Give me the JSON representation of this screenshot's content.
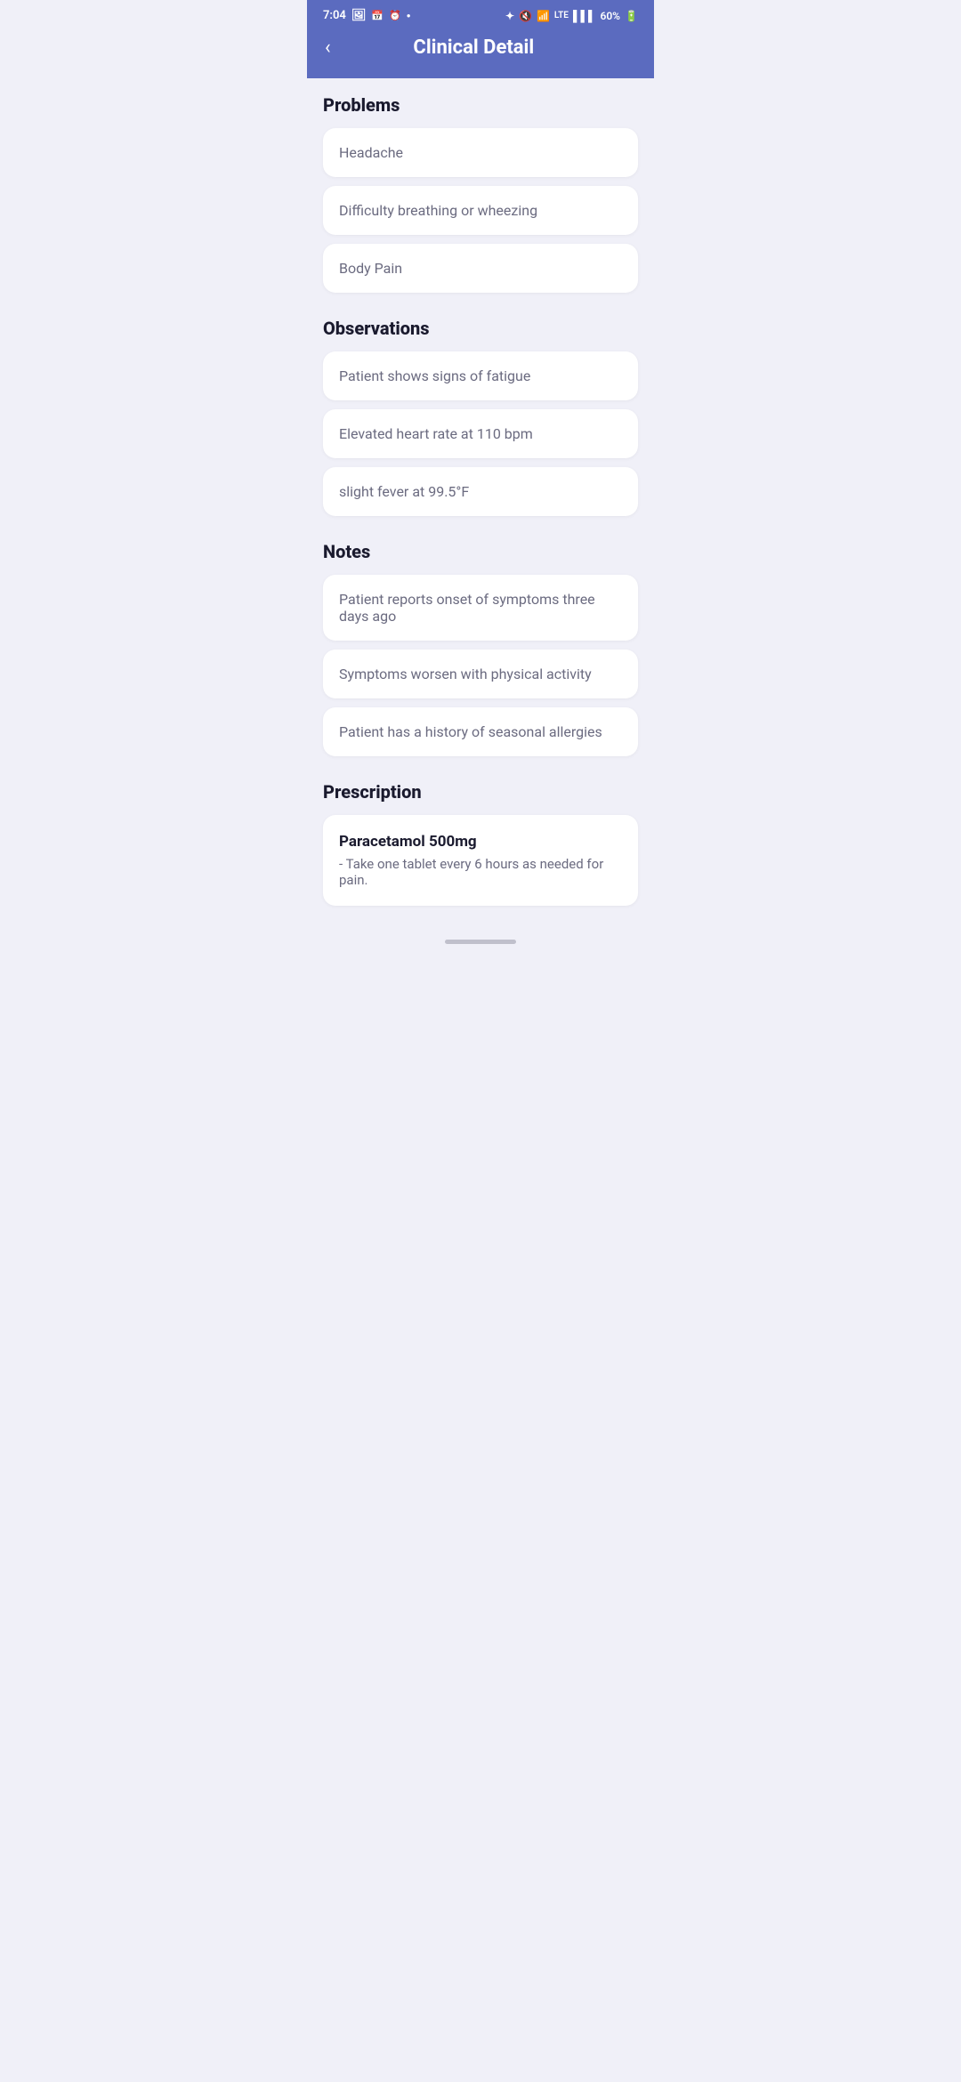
{
  "statusBar": {
    "time": "7:04",
    "battery": "60%"
  },
  "header": {
    "backLabel": "‹",
    "title": "Clinical Detail"
  },
  "sections": {
    "problems": {
      "title": "Problems",
      "items": [
        {
          "text": "Headache"
        },
        {
          "text": "Difficulty breathing or wheezing"
        },
        {
          "text": "Body Pain"
        }
      ]
    },
    "observations": {
      "title": "Observations",
      "items": [
        {
          "text": "Patient shows signs of fatigue"
        },
        {
          "text": "Elevated heart rate at 110 bpm"
        },
        {
          "text": "slight fever at 99.5°F"
        }
      ]
    },
    "notes": {
      "title": "Notes",
      "items": [
        {
          "text": "Patient reports onset of symptoms three days ago"
        },
        {
          "text": "Symptoms worsen with physical activity"
        },
        {
          "text": "Patient has a history of seasonal allergies"
        }
      ]
    },
    "prescription": {
      "title": "Prescription",
      "items": [
        {
          "name": "Paracetamol 500mg",
          "description": "- Take one tablet every 6 hours as needed for pain."
        }
      ]
    }
  }
}
